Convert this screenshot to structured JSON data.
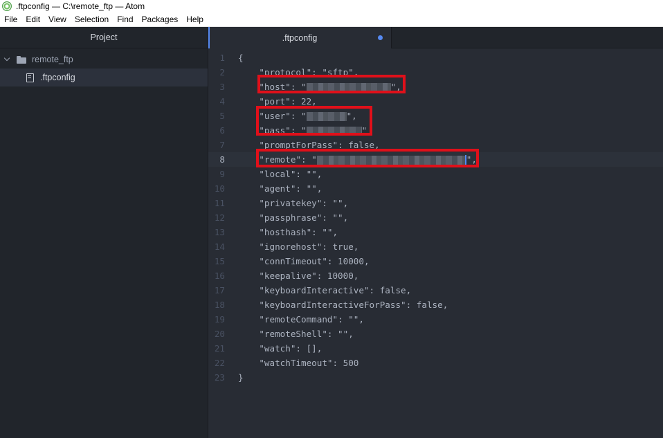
{
  "window": {
    "title": ".ftpconfig — C:\\remote_ftp — Atom"
  },
  "menu": [
    "File",
    "Edit",
    "View",
    "Selection",
    "Find",
    "Packages",
    "Help"
  ],
  "tree_view": {
    "header": "Project",
    "root_folder": "remote_ftp",
    "files": [
      ".ftpconfig"
    ]
  },
  "tab": {
    "title": ".ftpconfig",
    "modified": true
  },
  "editor": {
    "line_numbers": [
      "1",
      "2",
      "3",
      "4",
      "5",
      "6",
      "7",
      "8",
      "9",
      "10",
      "11",
      "12",
      "13",
      "14",
      "15",
      "16",
      "17",
      "18",
      "19",
      "20",
      "21",
      "22",
      "23"
    ],
    "lines": [
      "{",
      "    \"protocol\": \"sftp\",",
      "    \"host\": \"",
      "    \"port\": 22,",
      "    \"user\": \"",
      "    \"pass\": \"",
      "    \"promptForPass\": false,",
      "    \"remote\": \"",
      "    \"local\": \"\",",
      "    \"agent\": \"\",",
      "    \"privatekey\": \"\",",
      "    \"passphrase\": \"\",",
      "    \"hosthash\": \"\",",
      "    \"ignorehost\": true,",
      "    \"connTimeout\": 10000,",
      "    \"keepalive\": 10000,",
      "    \"keyboardInteractive\": false,",
      "    \"keyboardInteractiveForPass\": false,",
      "    \"remoteCommand\": \"\",",
      "    \"remoteShell\": \"\",",
      "    \"watch\": [],",
      "    \"watchTimeout\": 500",
      "}"
    ],
    "redacted_suffix": {
      "host": "\",",
      "user": "\",",
      "pass": "\"",
      "remote": "\","
    },
    "cursor_line": 8
  },
  "colors": {
    "accent": "#568af2",
    "highlight_box": "#e0101a"
  }
}
